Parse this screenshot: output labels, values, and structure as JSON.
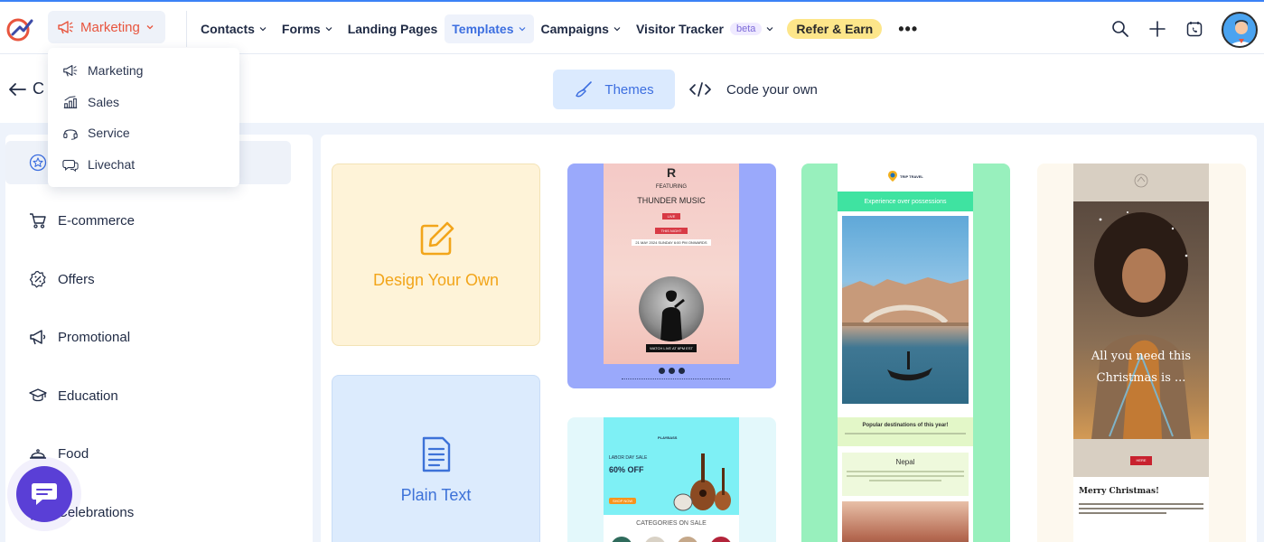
{
  "colors": {
    "brand_orange": "#e8553e",
    "accent_blue": "#3d6fe0",
    "refer_yellow": "#fde68a",
    "chat_purple": "#5a3fd6",
    "top_border": "#3b82f6"
  },
  "topnav": {
    "product_label": "Marketing",
    "items": [
      {
        "label": "Contacts",
        "has_menu": true
      },
      {
        "label": "Forms",
        "has_menu": true
      },
      {
        "label": "Landing Pages",
        "has_menu": false
      },
      {
        "label": "Templates",
        "has_menu": true,
        "active": true
      },
      {
        "label": "Campaigns",
        "has_menu": true
      },
      {
        "label": "Visitor Tracker",
        "has_menu": true,
        "badge": "beta"
      }
    ],
    "refer_label": "Refer & Earn",
    "more_label": "•••",
    "icons": [
      "search-icon",
      "plus-icon",
      "calendar-phone-icon",
      "user-avatar"
    ]
  },
  "product_menu": {
    "items": [
      {
        "label": "Marketing",
        "icon": "megaphone-icon"
      },
      {
        "label": "Sales",
        "icon": "chart-icon"
      },
      {
        "label": "Service",
        "icon": "headset-icon"
      },
      {
        "label": "Livechat",
        "icon": "chat-icon"
      }
    ]
  },
  "subheader": {
    "back_text": "C",
    "tabs": [
      {
        "label": "Themes",
        "active": true,
        "icon": "brush-icon"
      },
      {
        "label": "Code your own",
        "active": false,
        "icon": "code-icon"
      }
    ]
  },
  "sidebar": {
    "items": [
      {
        "label": "",
        "icon": "star-icon",
        "active": true
      },
      {
        "label": "E-commerce",
        "icon": "cart-icon"
      },
      {
        "label": "Offers",
        "icon": "percent-icon"
      },
      {
        "label": "Promotional",
        "icon": "megaphone-icon"
      },
      {
        "label": "Education",
        "icon": "graduation-cap-icon"
      },
      {
        "label": "Food",
        "icon": "cloche-icon"
      },
      {
        "label": "Celebrations",
        "icon": "party-icon"
      }
    ]
  },
  "cards": {
    "design_own": "Design Your Own",
    "plain_text": "Plain Text"
  },
  "templates": {
    "music": {
      "logo": "R",
      "featuring": "FEATURING",
      "title": "THUNDER MUSIC",
      "live": "LIVE",
      "tonight": "THIS NIGHT",
      "date": "21 MAY 2024 SUNDAY 6:00 PM ONWARDS",
      "watch": "WATCH LIVE AT 6PM EST"
    },
    "store": {
      "brand": "PLAYBASS",
      "sale": "LABOR DAY SALE",
      "off": "60% OFF",
      "shop": "SHOP NOW",
      "categories": "CATEGORIES ON SALE"
    },
    "travel": {
      "brand": "TRIP TRAVEL",
      "banner": "Experience over possessions",
      "popular": "Popular destinations of this year!",
      "place": "Nepal"
    },
    "xmas": {
      "message_line1": "All you need this",
      "message_line2": "Christmas is ...",
      "button": "HERE",
      "merry": "Merry Christmas!"
    }
  }
}
